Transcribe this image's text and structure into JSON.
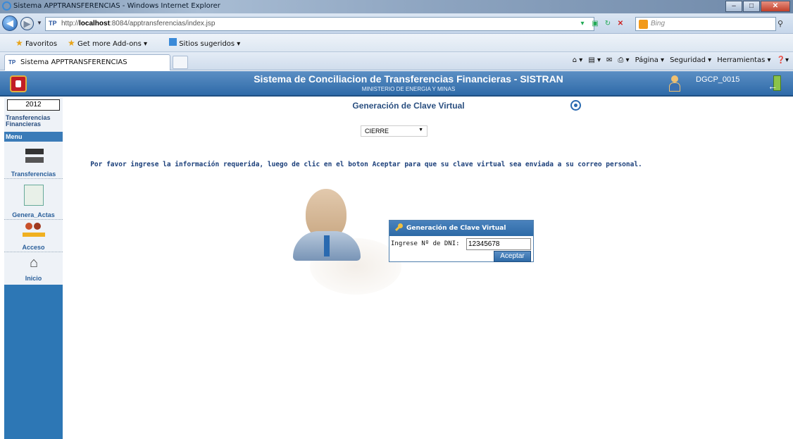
{
  "browser": {
    "window_title": "Sistema APPTRANSFERENCIAS - Windows Internet Explorer",
    "url_prefix": "http://",
    "url_host": "localhost",
    "url_rest": ":8084/apptransferencias/index.jsp",
    "search_placeholder": "Bing",
    "favorites_label": "Favoritos",
    "addons_label": "Get more Add-ons ▾",
    "sitios_label": "Sitios sugeridos ▾",
    "tab_label": "Sistema APPTRANSFERENCIAS",
    "cmd_pagina": "Página ▾",
    "cmd_seguridad": "Seguridad ▾",
    "cmd_herramientas": "Herramientas ▾",
    "favicon_text": "TP"
  },
  "header": {
    "title": "Sistema de Conciliacion de Transferencias Financieras - SISTRAN",
    "subtitle": "MINISTERIO DE ENERGIA Y MINAS",
    "user": "DGCP_0015"
  },
  "sidebar": {
    "year": "2012",
    "section_label_1": "Transferencias",
    "section_label_2": "Financieras",
    "menu_label": "Menu",
    "items": [
      {
        "label": "Transferencias"
      },
      {
        "label": "Genera_Actas"
      },
      {
        "label": "Acceso"
      },
      {
        "label": "Inicio"
      }
    ]
  },
  "main": {
    "title": "Generación de Clave Virtual",
    "select_value": "CIERRE",
    "instructions": "Por favor ingrese la información requerida, luego de clic en el boton Aceptar para que su clave virtual sea enviada a su correo personal."
  },
  "form": {
    "title": "Generación de Clave Virtual",
    "dni_label": "Ingrese Nº de DNI:",
    "dni_value": "12345678",
    "submit_label": "Aceptar"
  }
}
